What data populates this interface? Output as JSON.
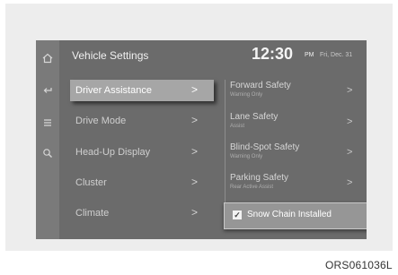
{
  "rail": {
    "icons": [
      "home-icon",
      "back-icon",
      "menu-icon",
      "search-icon"
    ]
  },
  "header": {
    "title": "Vehicle Settings",
    "time": "12:30",
    "ampm": "PM",
    "date": "Fri, Dec. 31"
  },
  "menu": {
    "items": [
      {
        "label": "Driver Assistance",
        "chevron": ">"
      },
      {
        "label": "Drive Mode",
        "chevron": ">"
      },
      {
        "label": "Head-Up Display",
        "chevron": ">"
      },
      {
        "label": "Cluster",
        "chevron": ">"
      },
      {
        "label": "Climate",
        "chevron": ">"
      }
    ],
    "selected": "Driver Assistance"
  },
  "options": {
    "items": [
      {
        "name": "Forward Safety",
        "sub": "Warning Only",
        "chevron": ">"
      },
      {
        "name": "Lane Safety",
        "sub": "Assist",
        "chevron": ">"
      },
      {
        "name": "Blind-Spot Safety",
        "sub": "Warning Only",
        "chevron": ">"
      },
      {
        "name": "Parking Safety",
        "sub": "Rear Active Assist",
        "chevron": ">"
      }
    ]
  },
  "snow_chain": {
    "label": "Snow Chain Installed",
    "check": "✓",
    "checked": true
  },
  "caption": "ORS061036L"
}
